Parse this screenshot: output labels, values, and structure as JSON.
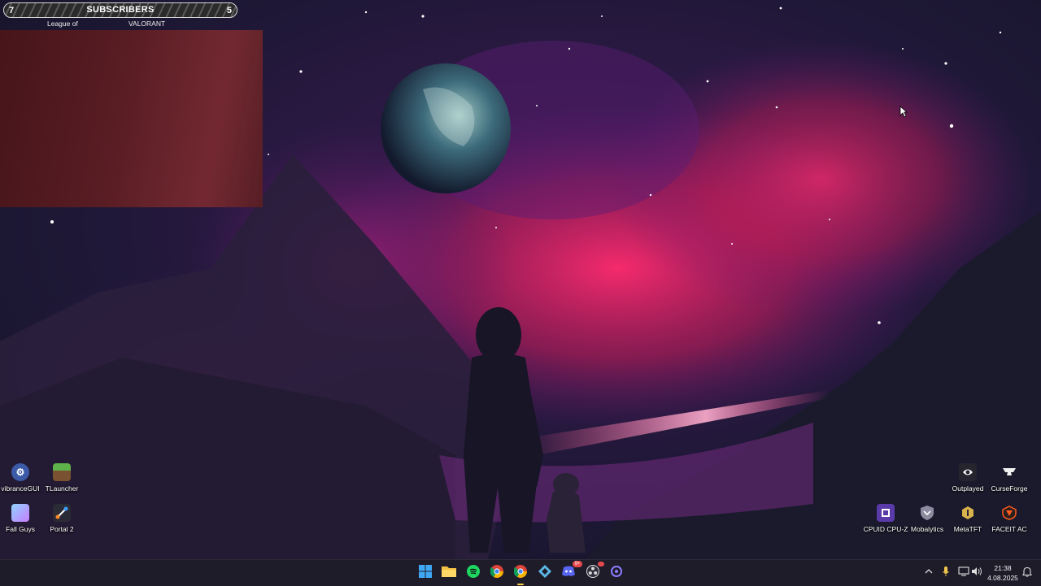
{
  "overlay": {
    "left_count": "7",
    "title": "SUBSCRIBERS",
    "right_count": "5",
    "left_label": "League of",
    "right_label": "VALORANT"
  },
  "desktop_left": [
    {
      "label": "vibranceGUI",
      "icon": "gear-icon"
    },
    {
      "label": "TLauncher",
      "icon": "grass-block-icon"
    },
    {
      "label": "Fall Guys",
      "icon": "fall-guys-icon"
    },
    {
      "label": "Portal 2",
      "icon": "portal-icon"
    }
  ],
  "desktop_right": [
    {
      "label": "Outplayed",
      "icon": "outplayed-icon"
    },
    {
      "label": "CurseForge",
      "icon": "anvil-icon"
    },
    {
      "label": "CPUID CPU-Z",
      "icon": "cpu-z-icon"
    },
    {
      "label": "Mobalytics",
      "icon": "shield-icon"
    },
    {
      "label": "MetaTFT",
      "icon": "metatft-icon"
    },
    {
      "label": "FACEIT AC",
      "icon": "faceit-icon"
    }
  ],
  "taskbar": {
    "apps": [
      {
        "name": "start-button",
        "icon": "windows-logo-icon"
      },
      {
        "name": "file-explorer",
        "icon": "folder-icon"
      },
      {
        "name": "spotify",
        "icon": "spotify-icon"
      },
      {
        "name": "chrome",
        "icon": "chrome-icon"
      },
      {
        "name": "chrome-active",
        "icon": "chrome-icon"
      },
      {
        "name": "app-diamond",
        "icon": "diamond-icon"
      },
      {
        "name": "discord",
        "icon": "discord-icon",
        "badge": "9+"
      },
      {
        "name": "obs",
        "icon": "obs-icon"
      },
      {
        "name": "app-circle",
        "icon": "circle-app-icon"
      }
    ],
    "time": "21:38",
    "date": "4.08.2025"
  },
  "colors": {
    "taskbar_bg": "#1f1c2a",
    "accent_pink": "#e0245e",
    "nebula_purple": "#6a1a7a"
  }
}
